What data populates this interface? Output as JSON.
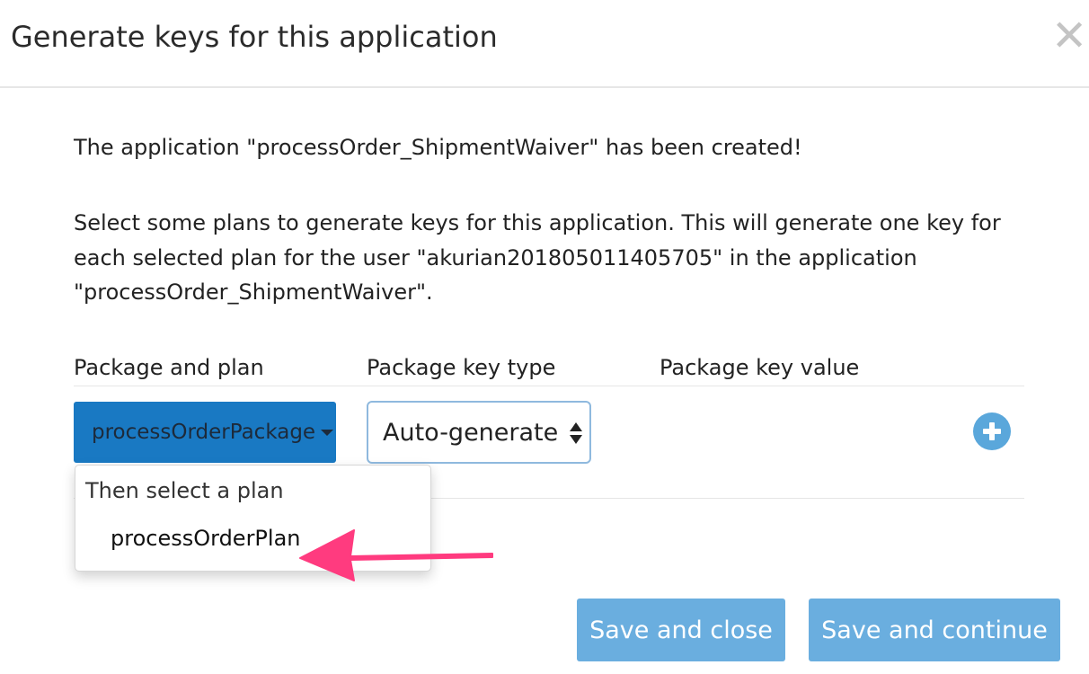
{
  "dialog": {
    "title": "Generate keys for this application",
    "close_icon": "close-icon"
  },
  "body": {
    "created_message": "The application \"processOrder_ShipmentWaiver\" has been created!",
    "instructions": "Select some plans to generate keys for this application. This will generate one key for each selected plan for the user \"akurian201805011405705\" in the application \"processOrder_ShipmentWaiver\"."
  },
  "table": {
    "headers": [
      "Package and plan",
      "Package key type",
      "Package key value"
    ],
    "row": {
      "package_button": "processOrderPackage",
      "key_type_value": "Auto-generate",
      "add_icon": "plus-circle-icon"
    }
  },
  "dropdown": {
    "header": "Then select a plan",
    "items": [
      "processOrderPlan"
    ]
  },
  "annotation": {
    "arrow_color": "#ff3b7f"
  },
  "footer": {
    "save_close": "Save and close",
    "save_continue": "Save and continue"
  },
  "colors": {
    "package_button": "#1979c3",
    "footer_buttons": "#6aaedf",
    "add_icon": "#5aa7db"
  }
}
